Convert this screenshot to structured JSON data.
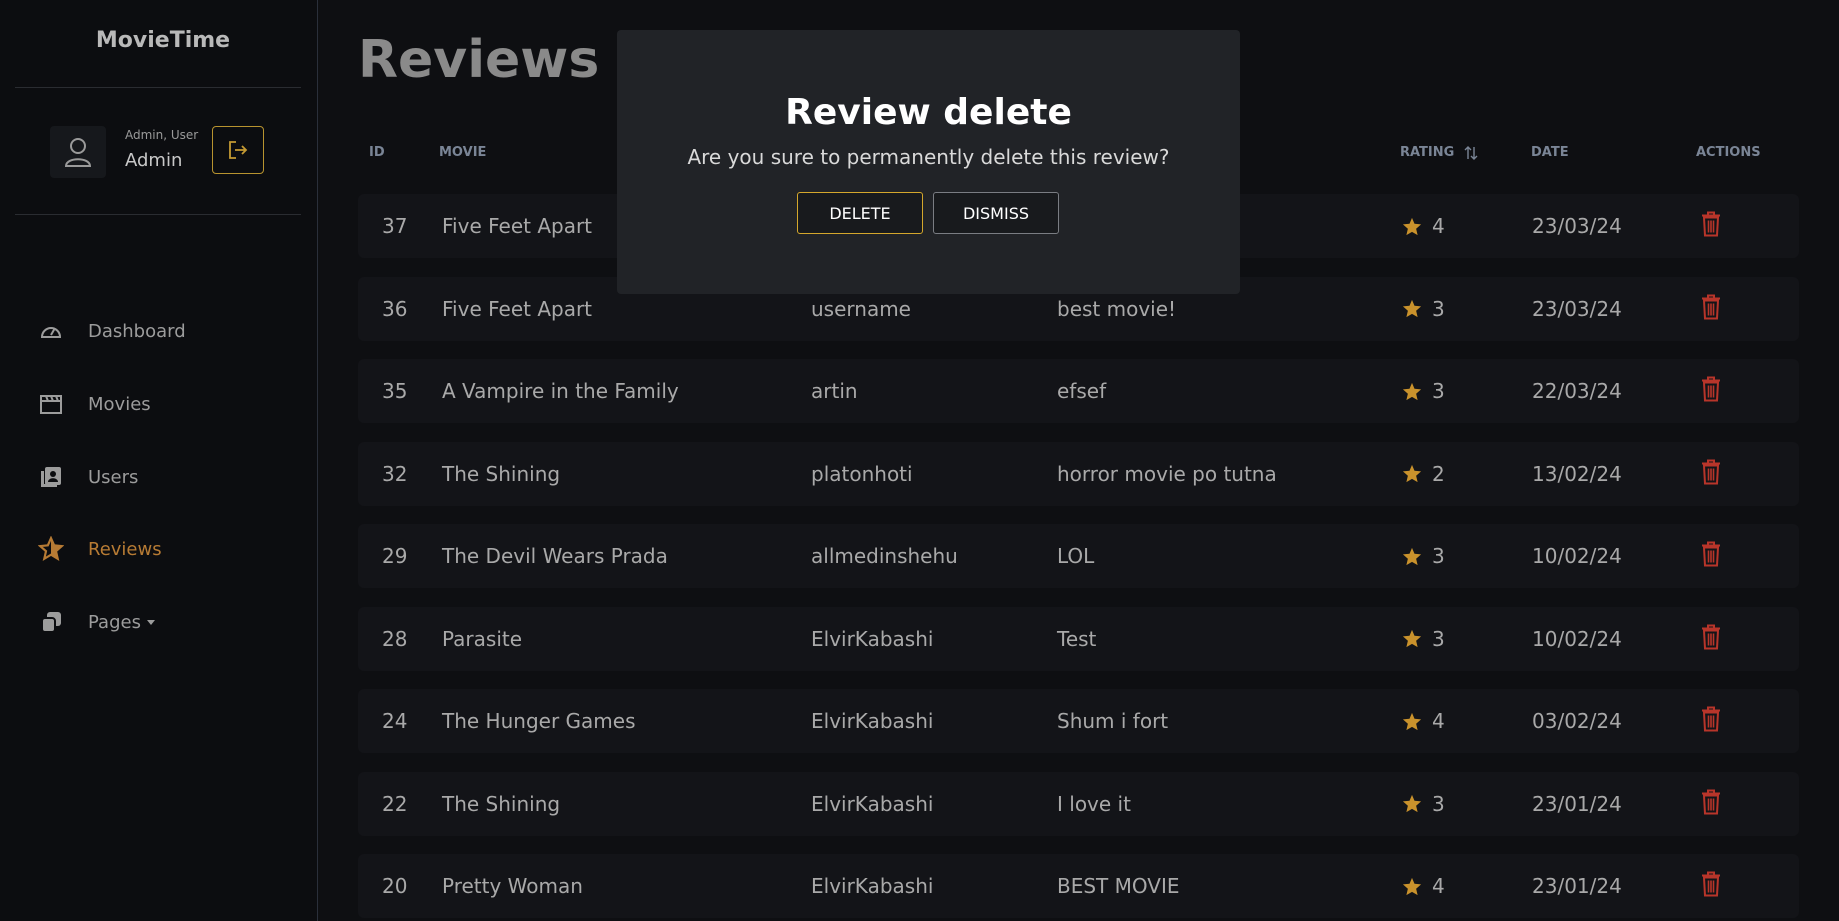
{
  "app": {
    "brand": "MovieTime"
  },
  "user": {
    "roles": "Admin, User",
    "name": "Admin"
  },
  "nav": [
    {
      "label": "Dashboard",
      "icon": "gauge-icon"
    },
    {
      "label": "Movies",
      "icon": "clapperboard-icon"
    },
    {
      "label": "Users",
      "icon": "users-book-icon"
    },
    {
      "label": "Reviews",
      "icon": "star-icon",
      "active": true
    },
    {
      "label": "Pages",
      "icon": "copy-icon",
      "dropdown": true
    }
  ],
  "page": {
    "title": "Reviews"
  },
  "table": {
    "headers": {
      "id": "ID",
      "movie": "MOVIE",
      "rating": "RATING",
      "date": "DATE",
      "actions": "ACTIONS"
    },
    "rows": [
      {
        "id": "37",
        "movie": "Five Feet Apart",
        "user": "",
        "review": "",
        "rating": "4",
        "date": "23/03/24"
      },
      {
        "id": "36",
        "movie": "Five Feet Apart",
        "user": "username",
        "review": "best movie!",
        "rating": "3",
        "date": "23/03/24"
      },
      {
        "id": "35",
        "movie": "A Vampire in the Family",
        "user": "artin",
        "review": "efsef",
        "rating": "3",
        "date": "22/03/24"
      },
      {
        "id": "32",
        "movie": "The Shining",
        "user": "platonhoti",
        "review": "horror movie po tutna",
        "rating": "2",
        "date": "13/02/24"
      },
      {
        "id": "29",
        "movie": "The Devil Wears Prada",
        "user": "allmedinshehu",
        "review": "LOL",
        "rating": "3",
        "date": "10/02/24"
      },
      {
        "id": "28",
        "movie": "Parasite",
        "user": "ElvirKabashi",
        "review": "Test",
        "rating": "3",
        "date": "10/02/24"
      },
      {
        "id": "24",
        "movie": "The Hunger Games",
        "user": "ElvirKabashi",
        "review": "Shum i fort",
        "rating": "4",
        "date": "03/02/24"
      },
      {
        "id": "22",
        "movie": "The Shining",
        "user": "ElvirKabashi",
        "review": "I love it",
        "rating": "3",
        "date": "23/01/24"
      },
      {
        "id": "20",
        "movie": "Pretty Woman",
        "user": "ElvirKabashi",
        "review": "BEST MOVIE",
        "rating": "4",
        "date": "23/01/24"
      }
    ]
  },
  "modal": {
    "title": "Review delete",
    "message": "Are you sure to permanently delete this review?",
    "delete_label": "DELETE",
    "dismiss_label": "DISMISS"
  },
  "colors": {
    "accent": "#b77b34",
    "delete_border": "#d4a72c",
    "trash": "#c0392b",
    "star": "#c9922c"
  }
}
